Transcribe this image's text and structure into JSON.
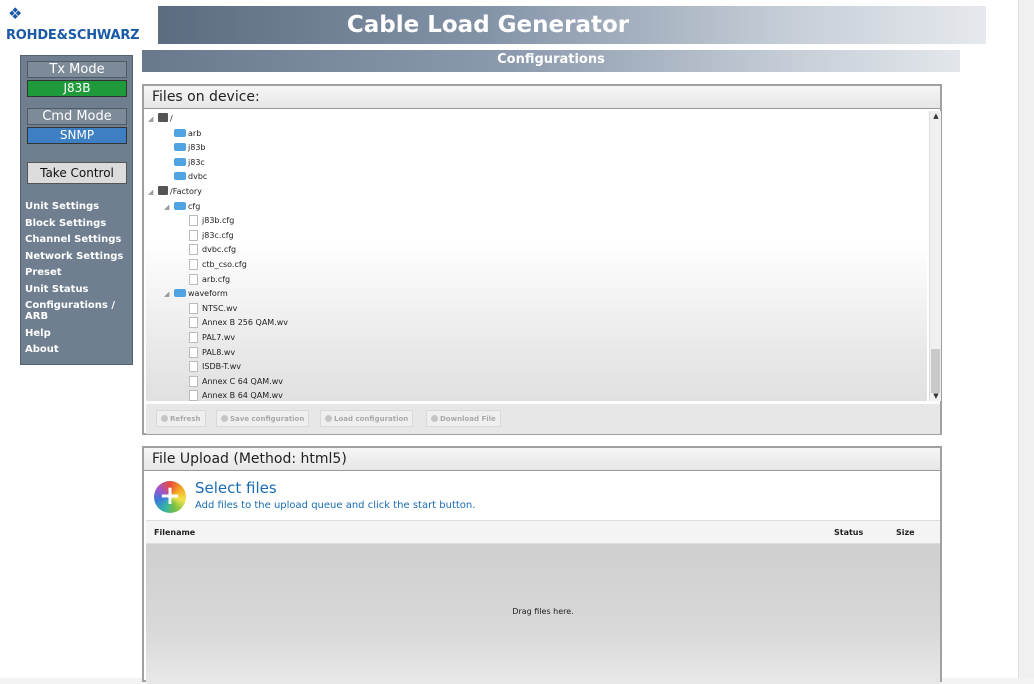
{
  "header": {
    "logo_text": "ROHDE&SCHWARZ",
    "title": "Cable Load Generator",
    "subtitle": "Configurations"
  },
  "sidebar": {
    "tx_mode_label": "Tx Mode",
    "tx_mode_value": "J83B",
    "tx_mode_color": "#1f9a3a",
    "cmd_mode_label": "Cmd Mode",
    "cmd_mode_value": "SNMP",
    "cmd_mode_color": "#3d7fc2",
    "take_control": "Take Control",
    "nav": [
      "Unit Settings",
      "Block Settings",
      "Channel Settings",
      "Network Settings",
      "Preset",
      "Unit Status",
      "Configurations / ARB",
      "Help",
      "About"
    ]
  },
  "files_panel": {
    "title": "Files on device:",
    "tree": [
      {
        "label": "/",
        "icon": "drive-icon",
        "depth": 0,
        "arrow": true
      },
      {
        "label": "arb",
        "icon": "folder-icon",
        "depth": 1
      },
      {
        "label": "j83b",
        "icon": "folder-icon",
        "depth": 1
      },
      {
        "label": "j83c",
        "icon": "folder-icon",
        "depth": 1
      },
      {
        "label": "dvbc",
        "icon": "folder-icon",
        "depth": 1
      },
      {
        "label": "/Factory",
        "icon": "drive-icon",
        "depth": 0,
        "arrow": true
      },
      {
        "label": "cfg",
        "icon": "folder-icon",
        "depth": 1,
        "arrow": true
      },
      {
        "label": "j83b.cfg",
        "icon": "file-icon",
        "depth": 2
      },
      {
        "label": "j83c.cfg",
        "icon": "file-icon",
        "depth": 2
      },
      {
        "label": "dvbc.cfg",
        "icon": "file-icon",
        "depth": 2
      },
      {
        "label": "ctb_cso.cfg",
        "icon": "file-icon",
        "depth": 2
      },
      {
        "label": "arb.cfg",
        "icon": "file-icon",
        "depth": 2
      },
      {
        "label": "waveform",
        "icon": "folder-icon",
        "depth": 1,
        "arrow": true
      },
      {
        "label": "NTSC.wv",
        "icon": "file-icon",
        "depth": 2
      },
      {
        "label": "Annex B 256 QAM.wv",
        "icon": "file-icon",
        "depth": 2
      },
      {
        "label": "PAL7.wv",
        "icon": "file-icon",
        "depth": 2
      },
      {
        "label": "PAL8.wv",
        "icon": "file-icon",
        "depth": 2
      },
      {
        "label": "ISDB-T.wv",
        "icon": "file-icon",
        "depth": 2
      },
      {
        "label": "Annex C 64 QAM.wv",
        "icon": "file-icon",
        "depth": 2
      },
      {
        "label": "Annex B 64 QAM.wv",
        "icon": "file-icon",
        "depth": 2
      }
    ],
    "buttons": [
      {
        "label": "Refresh",
        "name": "refresh-button"
      },
      {
        "label": "Save configuration",
        "name": "save-configuration-button"
      },
      {
        "label": "Load configuration",
        "name": "load-configuration-button"
      },
      {
        "label": "Download File",
        "name": "download-file-button"
      }
    ]
  },
  "upload_panel": {
    "title": "File Upload (Method: html5)",
    "select_files": "Select files",
    "hint": "Add files to the upload queue and click the start button.",
    "col_filename": "Filename",
    "col_status": "Status",
    "col_size": "Size",
    "drop_text": "Drag files here."
  }
}
